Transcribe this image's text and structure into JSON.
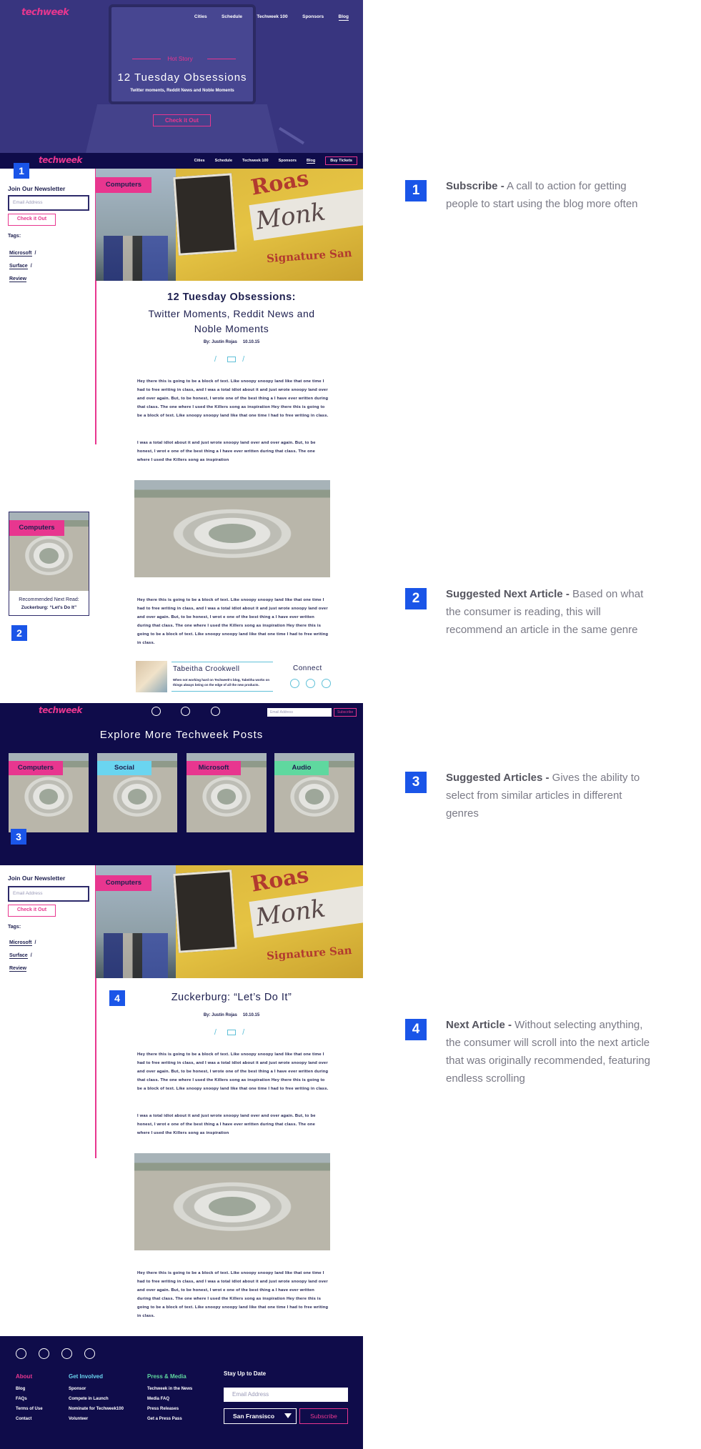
{
  "hero": {
    "logo": "techweek",
    "nav": [
      "Cities",
      "Schedule",
      "Techweek 100",
      "Sponsors",
      "Blog"
    ],
    "kicker": "Hot Story",
    "title": "12 Tuesday Obsessions",
    "subtitle": "Twitter moments, Reddit News and Noble Moments",
    "cta": "Check it Out"
  },
  "stickynav": {
    "logo": "techweek",
    "nav": [
      "Cities",
      "Schedule",
      "Techweek 100",
      "Sponsors",
      "Blog"
    ],
    "buy": "Buy Tickets"
  },
  "badges": [
    "1",
    "2",
    "3",
    "4"
  ],
  "sidebar": {
    "title": "Join Our Newsletter",
    "email_placeholder": "Email Address",
    "button": "Check it Out",
    "tags_label": "Tags:",
    "tags": [
      "Microsoft",
      "Surface",
      "Review"
    ],
    "tag_sep": "/"
  },
  "article1": {
    "category": "Computers",
    "photo_text": {
      "top": "Roas",
      "sign": "Monk",
      "bottom": "Signature San"
    },
    "title": "12 Tuesday Obsessions:",
    "subtitle_line1": "Twitter Moments, Reddit News and",
    "subtitle_line2": "Noble Moments",
    "author": "By: Justin Rojas",
    "date": "10.10.15",
    "slash": "/",
    "p1": "Hey there this is going to be a block of text. Like snoopy snoopy land like that one time I had to free writing in class, and I was a total idiot about it and just wrote snoopy land over and over again. But, to be honest, I wrote one of the best thing a I have ever written during that class. The one where I used the Killers song as inspiration Hey there this is going to be a block of text. Like snoopy snoopy land like that one time I had to free writing in class.",
    "p2": "I was a total idiot about it and just wrote snoopy land over and over again. But, to be honest, I wrot e one of the best thing a I have ever written during that class. The one where I used the Killers song as inspiration",
    "p3": "Hey there this is going to be a block of text. Like snoopy snoopy land like that one time I had to free writing in class, and I was a total idiot about it and just wrote snoopy land over and over again. But, to be honest, I wrot e one of the best thing a I have ever written during that class. The one where I used the Killers song as inspiration Hey there this is going to be a block of text. Like snoopy snoopy land like that one time I had to free writing in class."
  },
  "recommended": {
    "category": "Computers",
    "label": "Recommended Next Read:",
    "title": "Zuckerburg: “Let’s Do It”"
  },
  "author": {
    "name": "Tabeitha Crookwell",
    "bio": "When not working hard on Techweek's blog, Tabeitha works on things always being on the edge of all the new products.",
    "connect": "Connect"
  },
  "explore": {
    "logo": "techweek",
    "email_placeholder": "Email Address",
    "subscribe": "Subscribe",
    "title": "Explore More Techweek Posts",
    "cards": [
      "Computers",
      "Social",
      "Microsoft",
      "Audio"
    ]
  },
  "article2": {
    "category": "Computers",
    "title": "Zuckerburg: “Let’s Do It”",
    "author": "By: Justin Rojas",
    "date": "10.10.15"
  },
  "footer": {
    "col1": {
      "head": "About",
      "links": [
        "Blog",
        "FAQs",
        "Terms of Use",
        "Contact"
      ]
    },
    "col2": {
      "head": "Get Involved",
      "links": [
        "Sponsor",
        "Compete in Launch",
        "Nominate for Techweek100",
        "Volunteer"
      ]
    },
    "col3": {
      "head": "Press & Media",
      "links": [
        "Techweek in the News",
        "Media FAQ",
        "Press Releases",
        "Get a Press Pass"
      ]
    },
    "stay": "Stay Up to Date",
    "email_placeholder": "Email Address",
    "city": "San Fransisco",
    "subscribe": "Subscribe"
  },
  "annotations": [
    {
      "num": "1",
      "title": "Subscribe -",
      "text": " A call to action for getting people to start using the blog more often"
    },
    {
      "num": "2",
      "title": "Suggested Next Article -",
      "text": " Based on what the consumer is reading, this will recommend an article in the same genre"
    },
    {
      "num": "3",
      "title": "Suggested Articles -",
      "text": " Gives the ability to select from similar articles in different genres"
    },
    {
      "num": "4",
      "title": "Next Article -",
      "text": " Without selecting anything, the consumer will scroll into the next article that was originally recommended, featuring endless scrolling"
    }
  ],
  "colors": {
    "accent": "#e8368f",
    "navy": "#0f0c4a",
    "hero": "#38357f",
    "badge": "#1a55e8",
    "teal": "#5fc0d8"
  }
}
